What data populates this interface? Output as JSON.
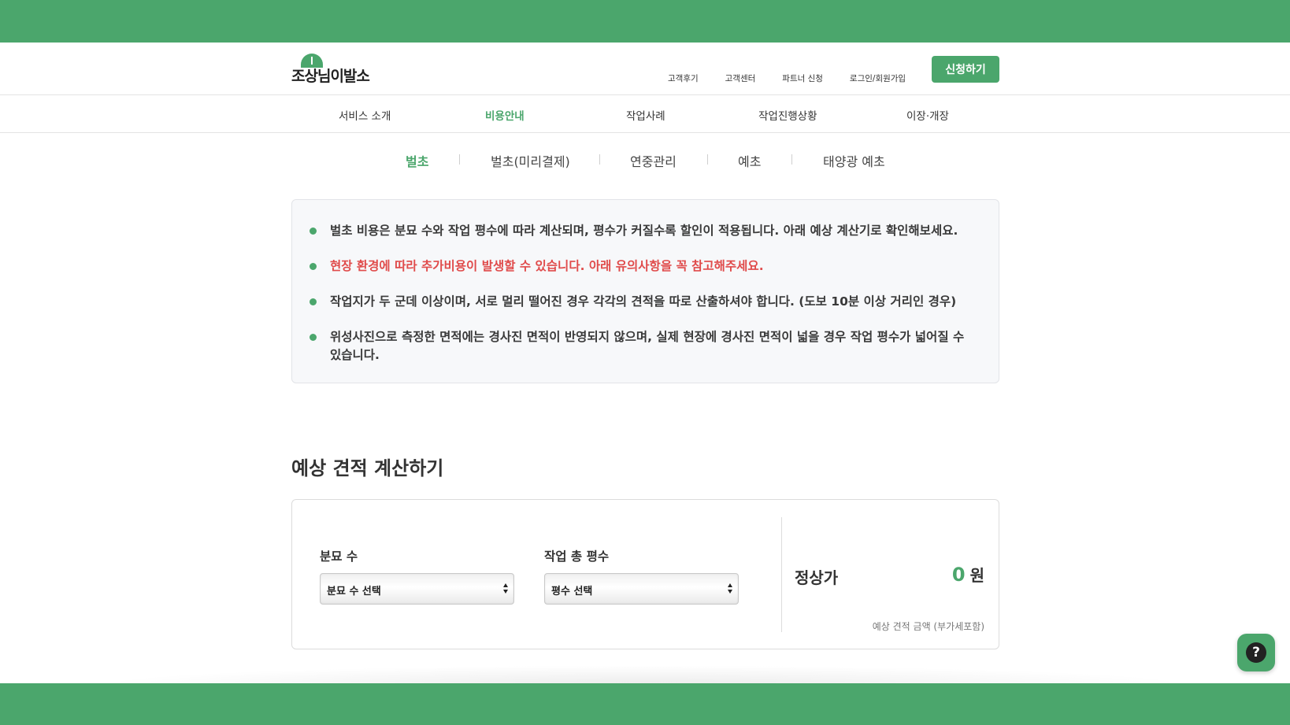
{
  "logo": {
    "text": "조상님이발소"
  },
  "header": {
    "util_links": [
      "고객후기",
      "고객센터",
      "파트너 신청",
      "로그인/회원가입"
    ],
    "apply_button": "신청하기"
  },
  "mainnav": [
    "서비스 소개",
    "비용안내",
    "작업사례",
    "작업진행상황",
    "이장·개장"
  ],
  "mainnav_active": "비용안내",
  "subtabs": [
    "벌초",
    "벌초(미리결제)",
    "연중관리",
    "예초",
    "태양광 예초"
  ],
  "subtabs_active": "벌초",
  "notice": [
    "벌초 비용은 분묘 수와 작업 평수에 따라 계산되며, 평수가 커질수록 할인이 적용됩니다. 아래 예상 계산기로 확인해보세요.",
    "현장 환경에 따라 추가비용이 발생할 수 있습니다. 아래 유의사항을 꼭 참고해주세요.",
    "작업지가 두 군데 이상이며, 서로 멀리 떨어진 경우 각각의 견적을 따로 산출하셔야 합니다. (도보 10분 이상 거리인 경우)",
    "위성사진으로 측정한 면적에는 경사진 면적이 반영되지 않으며, 실제 현장에 경사진 면적이 넓을 경우 작업 평수가 넓어질 수 있습니다."
  ],
  "calculator": {
    "title": "예상 견적 계산하기",
    "graves_label": "분묘 수",
    "graves_select": "분묘 수 선택",
    "area_label": "작업 총 평수",
    "area_select": "평수 선택",
    "price_label": "정상가",
    "price_value": "0",
    "price_unit": "원",
    "price_note": "예상 견적 금액 (부가세포함)"
  },
  "colors": {
    "brand": "#4ba66c",
    "warning": "#e04b4b"
  },
  "help_icon": "question-icon"
}
